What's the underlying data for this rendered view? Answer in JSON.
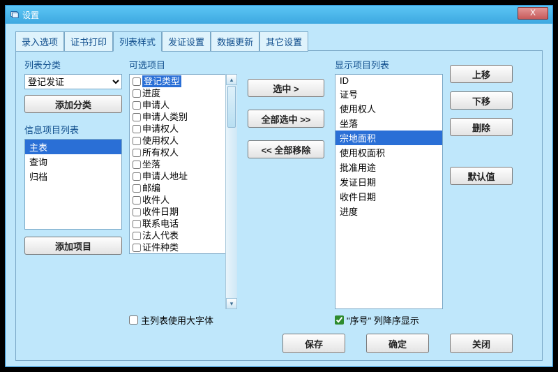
{
  "window": {
    "title": "设置",
    "close": "X"
  },
  "tabs": [
    "录入选项",
    "证书打印",
    "列表样式",
    "发证设置",
    "数据更新",
    "其它设置"
  ],
  "activeTab": 2,
  "labels": {
    "listCategory": "列表分类",
    "availItems": "可选项目",
    "displayList": "显示项目列表",
    "infoItemList": "信息项目列表"
  },
  "categorySelect": {
    "value": "登记发证"
  },
  "btns": {
    "addCategory": "添加分类",
    "addItem": "添加项目",
    "select": "选中 >",
    "selectAll": "全部选中 >>",
    "removeAll": "<< 全部移除",
    "moveUp": "上移",
    "moveDown": "下移",
    "delete": "删除",
    "default": "默认值",
    "save": "保存",
    "ok": "确定",
    "close": "关闭"
  },
  "infoItems": {
    "items": [
      "主表",
      "查询",
      "归档"
    ],
    "selectedIndex": 0
  },
  "availItems": {
    "items": [
      "登记类型",
      "进度",
      "申请人",
      "申请人类别",
      "申请权人",
      "使用权人",
      "所有权人",
      "坐落",
      "申请人地址",
      "邮编",
      "收件人",
      "收件日期",
      "联系电话",
      "法人代表",
      "证件种类"
    ],
    "selectedIndex": 0
  },
  "displayItems": {
    "items": [
      "ID",
      "证号",
      "使用权人",
      "坐落",
      "宗地面积",
      "使用权面积",
      "批准用途",
      "发证日期",
      "收件日期",
      "进度"
    ],
    "selectedIndex": 4
  },
  "checkboxes": {
    "bigFont": {
      "label": "主列表使用大字体",
      "checked": false
    },
    "orderDesc": {
      "label": "\"序号\" 列降序显示",
      "checked": true
    }
  }
}
